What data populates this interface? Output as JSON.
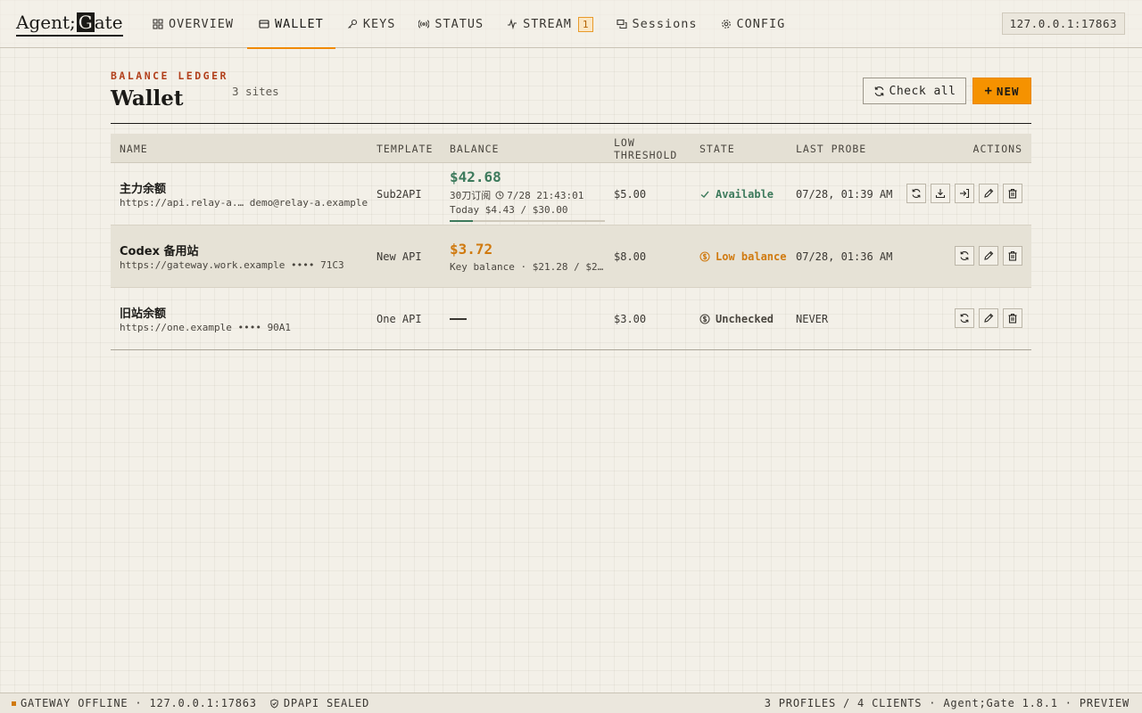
{
  "app": {
    "logo_text": "Agent;",
    "logo_mark": "G",
    "logo_tail": "ate",
    "address": "127.0.0.1:17863"
  },
  "nav": [
    {
      "label": "OVERVIEW",
      "icon": "grid-icon"
    },
    {
      "label": "WALLET",
      "icon": "wallet-icon",
      "active": true
    },
    {
      "label": "KEYS",
      "icon": "key-icon"
    },
    {
      "label": "STATUS",
      "icon": "signal-icon"
    },
    {
      "label": "STREAM",
      "icon": "pulse-icon",
      "badge": "1"
    },
    {
      "label": "Sessions",
      "icon": "chat-icon"
    },
    {
      "label": "CONFIG",
      "icon": "gear-icon"
    }
  ],
  "header": {
    "eyebrow": "BALANCE LEDGER",
    "title": "Wallet",
    "count": "3 sites",
    "check_all": "Check all",
    "new_label": "NEW"
  },
  "table": {
    "columns": [
      "NAME",
      "TEMPLATE",
      "BALANCE",
      "LOW\nTHRESHOLD",
      "STATE",
      "LAST PROBE",
      "ACTIONS"
    ],
    "rows": [
      {
        "name": "主力余额",
        "sub": "https://api.relay-a.… demo@relay-a.example",
        "template": "Sub2API",
        "balance": "$42.68",
        "balance_line1": "30刀订阅",
        "balance_time": "7/28 21:43:01",
        "balance_line2": "Today $4.43 / $30.00",
        "progress": 0.148,
        "threshold": "$5.00",
        "state": "Available",
        "last_probe": "07/28, 01:39 AM",
        "actions": [
          "refresh-icon",
          "download-icon",
          "login-icon",
          "edit-icon",
          "trash-icon"
        ]
      },
      {
        "name": "Codex 备用站",
        "sub": "https://gateway.work.example •••• 71C3",
        "template": "New API",
        "balance": "$3.72",
        "balance_line1": "Key balance · $21.28 / $2…",
        "threshold": "$8.00",
        "state": "Low balance",
        "last_probe": "07/28, 01:36 AM",
        "actions": [
          "refresh-icon",
          "edit-icon",
          "trash-icon"
        ]
      },
      {
        "name": "旧站余额",
        "sub": "https://one.example •••• 90A1",
        "template": "One API",
        "balance": "",
        "threshold": "$3.00",
        "state": "Unchecked",
        "last_probe": "NEVER",
        "actions": [
          "refresh-icon",
          "edit-icon",
          "trash-icon"
        ]
      }
    ]
  },
  "footer": {
    "status": "GATEWAY OFFLINE · 127.0.0.1:17863",
    "seal": "DPAPI SEALED",
    "right": "3 PROFILES / 4 CLIENTS · Agent;Gate 1.8.1 · PREVIEW"
  },
  "colors": {
    "accent": "#f59200",
    "ok": "#3d7a5c",
    "warn": "#d07a10",
    "eyebrow": "#b2401c"
  }
}
